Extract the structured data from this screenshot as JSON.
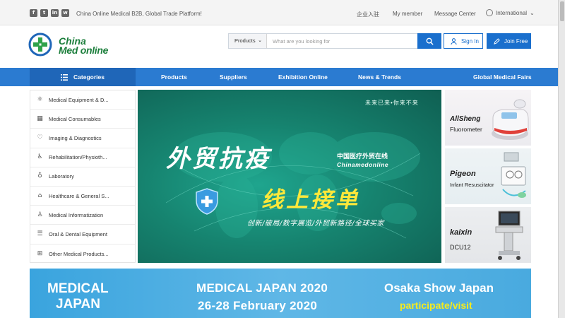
{
  "topbar": {
    "social_icons": [
      "facebook-icon",
      "twitter-icon",
      "linkedin-icon",
      "wechat-icon"
    ],
    "tagline": "China Online Medical B2B, Global Trade Platform!",
    "enter_link": "企业入驻",
    "member_link": "My member",
    "message_link": "Message Center",
    "language": "International"
  },
  "header": {
    "logo_line1": "China",
    "logo_line2": "Med online",
    "search_category": "Products",
    "search_placeholder": "What are you looking for",
    "signin_label": "Sign In",
    "join_label": "Join Free"
  },
  "nav": {
    "categories_label": "Categories",
    "items": [
      "Products",
      "Suppliers",
      "Exhibition Online",
      "News & Trends",
      "Global Medical Fairs"
    ]
  },
  "sidebar": {
    "items": [
      {
        "label": "Medical Equipment & D...",
        "icon": "atom-icon"
      },
      {
        "label": "Medical Consumables",
        "icon": "grid-icon"
      },
      {
        "label": "Imaging & Diagnostics",
        "icon": "heartbeat-icon"
      },
      {
        "label": "Rehabilitation/Physioth...",
        "icon": "wheelchair-icon"
      },
      {
        "label": "Laboratory",
        "icon": "tooth-icon"
      },
      {
        "label": "Healthcare & General S...",
        "icon": "home-icon"
      },
      {
        "label": "Medical Informatization",
        "icon": "person-icon"
      },
      {
        "label": "Oral & Dental Equipment",
        "icon": "list-icon"
      },
      {
        "label": "Other Medical Products...",
        "icon": "apps-icon"
      }
    ]
  },
  "banner": {
    "top_text": "未来已来•你来不来",
    "headline1": "外贸抗疫",
    "site_cn": "中国医疗外贸在线",
    "site_en": "Chinamedonline",
    "headline2": "线上接单",
    "slogan": "创新/破局/数字展览/外贸新路径/全球买家"
  },
  "ads": [
    {
      "brand": "AllSheng",
      "product": "Fluorometer"
    },
    {
      "brand": "Pigeon",
      "product": "Infant Resuscitator"
    },
    {
      "brand": "kaixin",
      "product": "DCU12"
    }
  ],
  "expo": {
    "logo_line1": "MEDICAL",
    "logo_line2": "JAPAN",
    "title": "MEDICAL JAPAN 2020",
    "dates": "26-28 February 2020",
    "location": "Osaka Show Japan",
    "cta": "participate/visit"
  },
  "colors": {
    "brand_blue": "#2b7bd1",
    "brand_green": "#1b7e3b",
    "banner_teal": "#16836f",
    "headline_yellow": "#ffe83a",
    "expo_blue": "#3aa4de",
    "expo_yellow": "#f5ea1e"
  }
}
